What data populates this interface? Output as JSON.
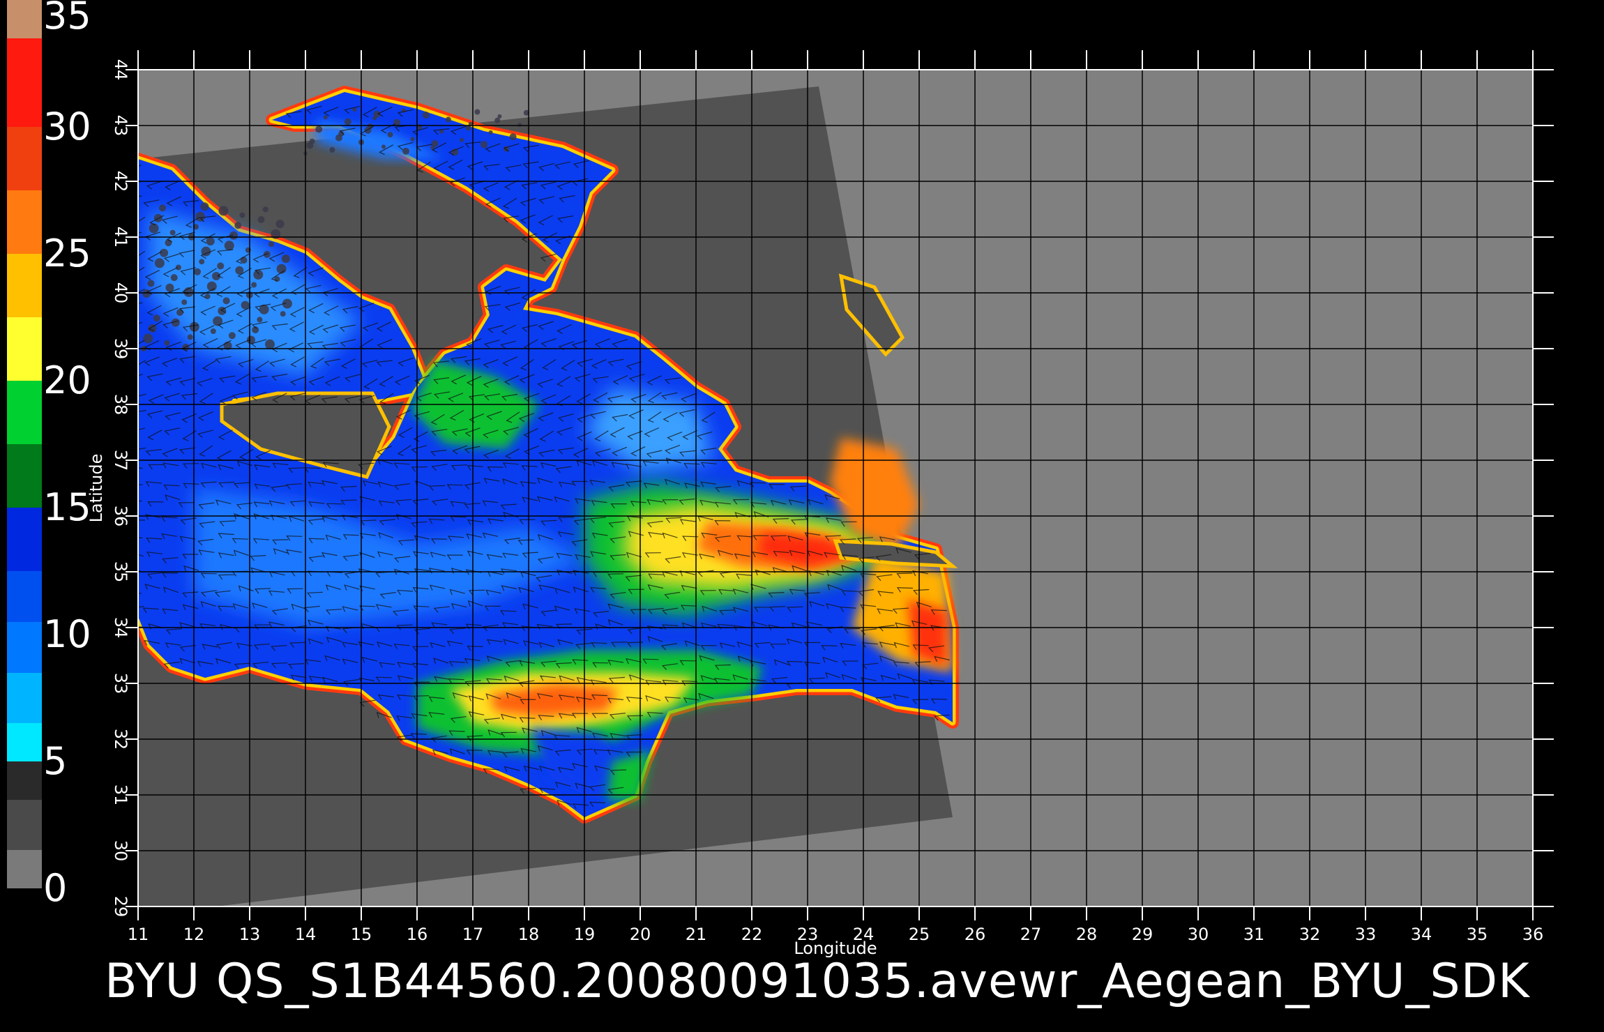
{
  "footer": {
    "title": "BYU  QS_S1B44560.20080091035.avewr_Aegean_BYU_SDK"
  },
  "axes": {
    "xlabel": "Longitude",
    "ylabel": "Latitude"
  },
  "colorbar": {
    "labels": [
      "35",
      "30",
      "25",
      "20",
      "15",
      "10",
      "5",
      "0"
    ],
    "range": [
      0,
      35
    ],
    "segments": [
      {
        "from": 0,
        "to": 1.5,
        "color": "#7a7a7a"
      },
      {
        "from": 1.5,
        "to": 3.5,
        "color": "#4a4a4a"
      },
      {
        "from": 3.5,
        "to": 5,
        "color": "#2a2a2a"
      },
      {
        "from": 5,
        "to": 6.5,
        "color": "#00e8ff"
      },
      {
        "from": 6.5,
        "to": 8.5,
        "color": "#00b4ff"
      },
      {
        "from": 8.5,
        "to": 10.5,
        "color": "#0078ff"
      },
      {
        "from": 10.5,
        "to": 12.5,
        "color": "#0050f0"
      },
      {
        "from": 12.5,
        "to": 15,
        "color": "#0028e0"
      },
      {
        "from": 15,
        "to": 17.5,
        "color": "#007a1a"
      },
      {
        "from": 17.5,
        "to": 20,
        "color": "#00d030"
      },
      {
        "from": 20,
        "to": 22.5,
        "color": "#ffff30"
      },
      {
        "from": 22.5,
        "to": 25,
        "color": "#ffc000"
      },
      {
        "from": 25,
        "to": 27.5,
        "color": "#ff7a10"
      },
      {
        "from": 27.5,
        "to": 30,
        "color": "#f04010"
      },
      {
        "from": 30,
        "to": 33.5,
        "color": "#ff1a10"
      },
      {
        "from": 33.5,
        "to": 35,
        "color": "#c8906a"
      }
    ]
  },
  "map": {
    "lon_ticks": [
      "11",
      "12",
      "13",
      "14",
      "15",
      "16",
      "17",
      "18",
      "19",
      "20",
      "21",
      "22",
      "23",
      "24",
      "25",
      "26",
      "27",
      "28",
      "29",
      "30",
      "31",
      "32",
      "33",
      "34",
      "35",
      "36"
    ],
    "lat_ticks": [
      "29",
      "30",
      "31",
      "32",
      "33",
      "34",
      "35",
      "36",
      "37",
      "38",
      "39",
      "40",
      "41",
      "42",
      "43",
      "44"
    ],
    "lon_range": [
      11,
      36
    ],
    "lat_range": [
      29,
      44
    ],
    "colors": {
      "background": "#808080",
      "swath": "#525252",
      "grid": "#000000"
    }
  }
}
